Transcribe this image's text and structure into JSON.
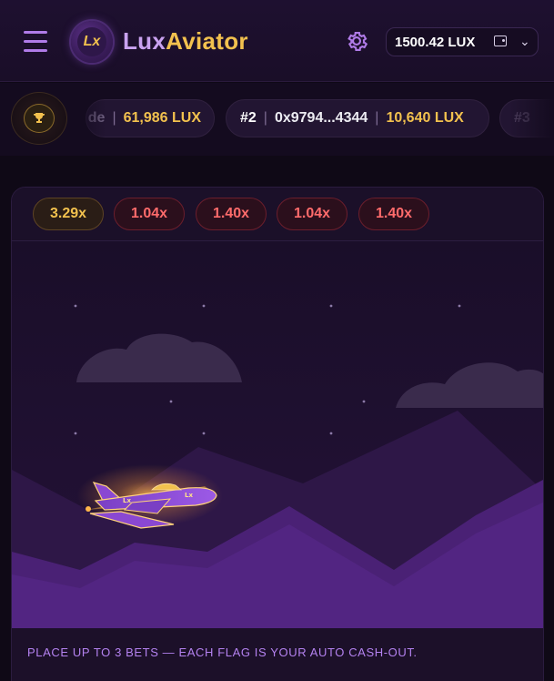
{
  "header": {
    "brand_part1": "Lux",
    "brand_part2": "Aviator",
    "logo_text": "Lx",
    "balance": "1500.42 LUX"
  },
  "leaderboard": [
    {
      "rank": "",
      "address": "de",
      "amount": "61,986 LUX"
    },
    {
      "rank": "#2",
      "address": "0x9794...4344",
      "amount": "10,640 LUX"
    },
    {
      "rank": "#3",
      "address": "",
      "amount": ""
    }
  ],
  "history": [
    "3.29x",
    "1.04x",
    "1.40x",
    "1.04x",
    "1.40x"
  ],
  "plane_label": "Lx",
  "footer": {
    "hint": "PLACE UP TO 3 BETS — EACH FLAG IS YOUR AUTO CASH-OUT."
  },
  "colors": {
    "accent": "#f2c14e",
    "purple": "#b07be8",
    "loss": "#ff6b6b",
    "bg": "#0f0916"
  }
}
